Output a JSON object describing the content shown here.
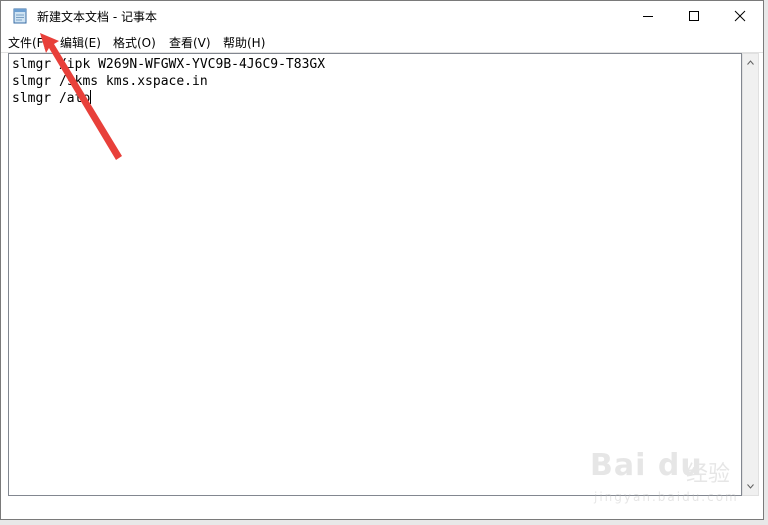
{
  "window": {
    "title": "新建文本文档 - 记事本",
    "app_icon": "notepad-icon",
    "controls": {
      "minimize": "minimize-icon",
      "maximize": "maximize-icon",
      "close": "close-icon"
    }
  },
  "menu": {
    "items": [
      {
        "label": "文件(F)"
      },
      {
        "label": "编辑(E)"
      },
      {
        "label": "格式(O)"
      },
      {
        "label": "查看(V)"
      },
      {
        "label": "帮助(H)"
      }
    ]
  },
  "editor": {
    "lines": [
      "slmgr /ipk W269N-WFGWX-YVC9B-4J6C9-T83GX",
      "slmgr /skms kms.xspace.in",
      "slmgr /ato"
    ]
  },
  "watermark": {
    "logo": "Bai du",
    "text": "经验",
    "url": "jingyan.baidu.com"
  },
  "colors": {
    "annotation_arrow": "#e8403a",
    "window_border": "#7a7a7a",
    "background": "#ffffff"
  }
}
